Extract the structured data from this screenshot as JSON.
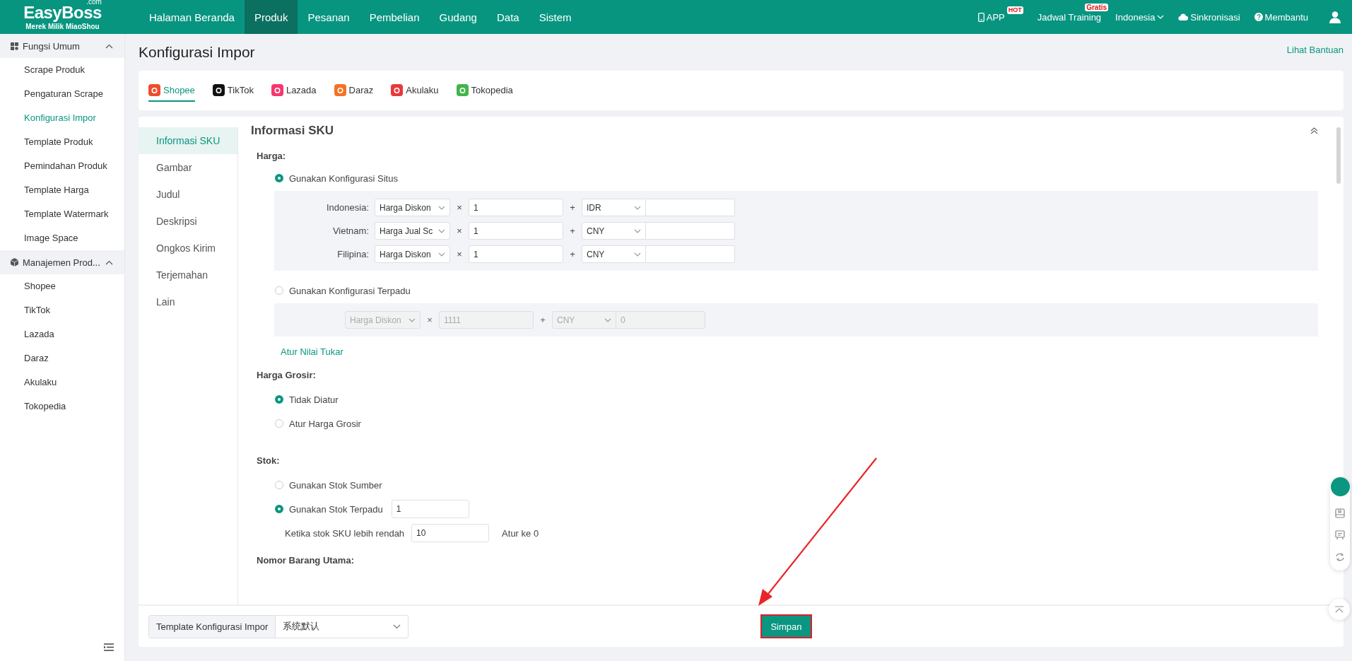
{
  "topbar": {
    "logo": {
      "name": "EasyBoss",
      "suffix": ".com",
      "tagline": "Merek Milik MiaoShou"
    },
    "menu": [
      {
        "label": "Halaman Beranda",
        "selected": false
      },
      {
        "label": "Produk",
        "selected": true
      },
      {
        "label": "Pesanan",
        "selected": false
      },
      {
        "label": "Pembelian",
        "selected": false
      },
      {
        "label": "Gudang",
        "selected": false
      },
      {
        "label": "Data",
        "selected": false
      },
      {
        "label": "Sistem",
        "selected": false
      }
    ],
    "app": {
      "label": "APP",
      "badge": "HOT"
    },
    "training": {
      "label": "Jadwal Training",
      "badge": "Gratis"
    },
    "language": "Indonesia",
    "sync": "Sinkronisasi",
    "help": "Membantu"
  },
  "sidebar": {
    "groups": [
      {
        "title": "Fungsi Umum",
        "kind": "grid",
        "expanded": true,
        "items": [
          {
            "label": "Scrape Produk",
            "selected": false
          },
          {
            "label": "Pengaturan Scrape",
            "selected": false
          },
          {
            "label": "Konfigurasi Impor",
            "selected": true
          },
          {
            "label": "Template Produk",
            "selected": false
          },
          {
            "label": "Pemindahan Produk",
            "selected": false
          },
          {
            "label": "Template Harga",
            "selected": false
          },
          {
            "label": "Template Watermark",
            "selected": false
          },
          {
            "label": "Image Space",
            "selected": false
          }
        ]
      },
      {
        "title": "Manajemen Prod...",
        "kind": "box",
        "expanded": true,
        "items": [
          {
            "label": "Shopee",
            "selected": false
          },
          {
            "label": "TikTok",
            "selected": false
          },
          {
            "label": "Lazada",
            "selected": false
          },
          {
            "label": "Daraz",
            "selected": false
          },
          {
            "label": "Akulaku",
            "selected": false
          },
          {
            "label": "Tokopedia",
            "selected": false
          }
        ]
      }
    ]
  },
  "page": {
    "title": "Konfigurasi Impor",
    "help_link": "Lihat Bantuan"
  },
  "platform_tabs": [
    {
      "label": "Shopee",
      "selected": true,
      "color": "#ee4d2d"
    },
    {
      "label": "TikTok",
      "selected": false,
      "color": "#111111"
    },
    {
      "label": "Lazada",
      "selected": false,
      "color": "#f5366f"
    },
    {
      "label": "Daraz",
      "selected": false,
      "color": "#f57224"
    },
    {
      "label": "Akulaku",
      "selected": false,
      "color": "#e8383d"
    },
    {
      "label": "Tokopedia",
      "selected": false,
      "color": "#42b549"
    }
  ],
  "subnav": [
    {
      "label": "Informasi SKU",
      "selected": true
    },
    {
      "label": "Gambar",
      "selected": false
    },
    {
      "label": "Judul",
      "selected": false
    },
    {
      "label": "Deskripsi",
      "selected": false
    },
    {
      "label": "Ongkos Kirim",
      "selected": false
    },
    {
      "label": "Terjemahan",
      "selected": false
    },
    {
      "label": "Lain",
      "selected": false
    }
  ],
  "section": {
    "title": "Informasi SKU",
    "price": {
      "label": "Harga:",
      "options": [
        {
          "kind": "site",
          "label": "Gunakan Konfigurasi Situs",
          "selected": true,
          "rows": [
            {
              "country": "Indonesia:",
              "price_type": "Harga Diskon",
              "times": "×",
              "multiplier": "1",
              "plus": "+",
              "currency": "IDR"
            },
            {
              "country": "Vietnam:",
              "price_type": "Harga Jual Sc",
              "times": "×",
              "multiplier": "1",
              "plus": "+",
              "currency": "CNY"
            },
            {
              "country": "Filipina:",
              "price_type": "Harga Diskon",
              "times": "×",
              "multiplier": "1",
              "plus": "+",
              "currency": "CNY"
            }
          ]
        },
        {
          "kind": "unified",
          "label": "Gunakan Konfigurasi Terpadu",
          "selected": false,
          "rows": [
            {
              "price_type": "Harga Diskon",
              "times": "×",
              "multiplier": "1111",
              "plus": "+",
              "currency": "CNY",
              "addend": "0"
            }
          ]
        }
      ],
      "exchange_link": "Atur Nilai Tukar"
    },
    "wholesale": {
      "label": "Harga Grosir:",
      "options": [
        {
          "label": "Tidak Diatur",
          "selected": true
        },
        {
          "label": "Atur Harga Grosir",
          "selected": false
        }
      ]
    },
    "stock": {
      "label": "Stok:",
      "options": [
        {
          "label": "Gunakan Stok Sumber",
          "selected": false
        },
        {
          "label": "Gunakan Stok Terpadu",
          "selected": true,
          "value": "1"
        }
      ],
      "threshold": {
        "label": "Ketika stok SKU lebih rendah",
        "value": "10",
        "suffix": "Atur ke 0"
      }
    },
    "main_item_label": "Nomor Barang Utama:"
  },
  "footer": {
    "template_label": "Template Konfigurasi Impor",
    "template_value": "系统默认",
    "save": "Simpan"
  }
}
